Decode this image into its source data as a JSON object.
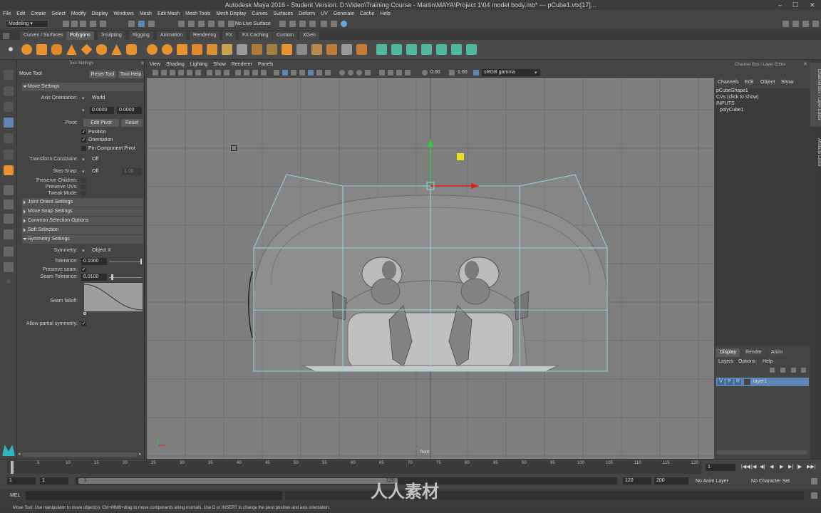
{
  "window": {
    "title": "Autodesk Maya 2016 - Student Version: D:\\Video\\Training Course - Martin\\MAYA\\Project 1\\04 model body.mb*   ---   pCube1.vtx[17]...",
    "controls": [
      "–",
      "☐",
      "✕"
    ]
  },
  "menubar": [
    "File",
    "Edit",
    "Create",
    "Select",
    "Modify",
    "Display",
    "Windows",
    "Mesh",
    "Edit Mesh",
    "Mesh Tools",
    "Mesh Display",
    "Curves",
    "Surfaces",
    "Deform",
    "UV",
    "Generate",
    "Cache",
    "Help"
  ],
  "statusline": {
    "mode": "Modeling",
    "live_surface": "No Live Surface"
  },
  "shelf_tabs": [
    "Curves / Surfaces",
    "Polygons",
    "Sculpting",
    "Rigging",
    "Animation",
    "Rendering",
    "FX",
    "FX Caching",
    "Custom",
    "XGen"
  ],
  "shelf_active": "Polygons",
  "tool_settings": {
    "header": "Tool Settings",
    "tool_name": "Move Tool",
    "reset_tool": "Reset Tool",
    "tool_help": "Tool Help",
    "move_settings": "Move Settings",
    "axis_orientation_label": "Axis Orientation:",
    "axis_orientation": "World",
    "vec_a": "0.0000",
    "vec_b": "0.0000",
    "pivot_label": "Pivot:",
    "edit_pivot": "Edit Pivot",
    "reset": "Reset",
    "position": "Position",
    "orientation": "Orientation",
    "pin_component_pivot": "Pin Component Pivot",
    "transform_constraint_label": "Transform Constraint:",
    "transform_constraint": "Off",
    "step_snap_label": "Step Snap:",
    "step_snap": "Off",
    "step_value": "1.00",
    "preserve_children": "Preserve Children:",
    "preserve_uvs": "Preserve UVs:",
    "tweak_mode": "Tweak Mode:",
    "joint_orient": "Joint Orient Settings",
    "move_snap": "Move Snap Settings",
    "common_selection": "Common Selection Options",
    "soft_selection": "Soft Selection",
    "symmetry_settings": "Symmetry Settings",
    "symmetry_label": "Symmetry:",
    "symmetry": "Object X",
    "tolerance_label": "Tolerance:",
    "tolerance": "0.1000",
    "preserve_seam_label": "Preserve seam:",
    "seam_tolerance_label": "Seam Tolerance:",
    "seam_tolerance": "0.0100",
    "seam_falloff_label": "Seam falloff:",
    "allow_partial": "Allow partial symmetry:"
  },
  "panel_menu": [
    "View",
    "Shading",
    "Lighting",
    "Show",
    "Renderer",
    "Panels"
  ],
  "panel_toolbar": {
    "exposure": "0.00",
    "gamma": "1.00",
    "color_space": "sRGB gamma"
  },
  "viewport": {
    "camera_label": "front"
  },
  "channel_box": {
    "header": "Channel Box / Layer Editor",
    "menu": [
      "Channels",
      "Edit",
      "Object",
      "Show"
    ],
    "shape": "pCubeShape1",
    "cvs": "CVs (click to show)",
    "inputs": "INPUTS",
    "input_node": "polyCube1",
    "layer_tabs": [
      "Display",
      "Render",
      "Anim"
    ],
    "layer_menu": [
      "Layers",
      "Options",
      "Help"
    ],
    "layer_flags": [
      "V",
      "P",
      "R"
    ],
    "layer_name": "layer1"
  },
  "side_tabs": [
    "Channel Box / Layer Editor",
    "Attribute Editor"
  ],
  "time_slider": {
    "ticks": [
      "1",
      "5",
      "10",
      "15",
      "20",
      "25",
      "30",
      "35",
      "40",
      "45",
      "50",
      "55",
      "60",
      "65",
      "70",
      "75",
      "80",
      "85",
      "90",
      "95",
      "100",
      "105",
      "110",
      "115",
      "120"
    ],
    "current_frame": "1",
    "playback_buttons": [
      "|◀◀",
      "|◀",
      "◀|",
      "◀",
      "▶",
      "▶|",
      "|▶",
      "▶▶|"
    ]
  },
  "range_slider": {
    "start": "1",
    "start_inner": "1",
    "range_start_label": "1",
    "range_end_label": "120",
    "end_inner": "120",
    "end": "200",
    "anim_layer": "No Anim Layer",
    "character_set": "No Character Set"
  },
  "command_line": {
    "label": "MEL"
  },
  "help_line": "Move Tool: Use manipulator to move object(s). Ctrl+MMB+drag to move components along normals. Use D or INSERT to change the pivot position and axis orientation.",
  "watermark": "人人素材"
}
